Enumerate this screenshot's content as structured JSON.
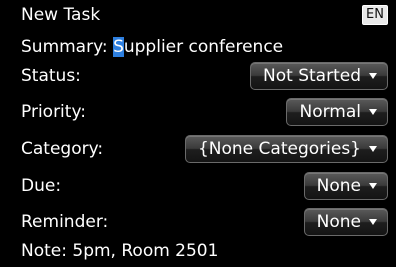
{
  "header": {
    "title": "New Task",
    "lang_badge": "EN"
  },
  "summary": {
    "label": "Summary:",
    "value_first_char": "S",
    "value_rest": "upplier conference"
  },
  "fields": {
    "status": {
      "label": "Status:",
      "value": "Not Started"
    },
    "priority": {
      "label": "Priority:",
      "value": "Normal"
    },
    "category": {
      "label": "Category:",
      "value": "{None Categories}"
    },
    "due": {
      "label": "Due:",
      "value": "None"
    },
    "reminder": {
      "label": "Reminder:",
      "value": "None"
    }
  },
  "note": {
    "label": "Note:",
    "value": "5pm, Room 2501"
  },
  "colors": {
    "background": "#000000",
    "text": "#ffffff",
    "cursor_highlight": "#2d7fe0"
  },
  "icons": {
    "dropdown_caret": "caret-down-icon"
  }
}
